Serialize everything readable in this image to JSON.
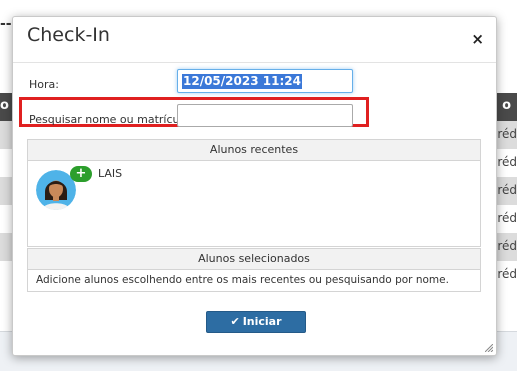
{
  "background": {
    "header_left": "o d",
    "header_right": "o",
    "rows": [
      "créd",
      "créd",
      "créd",
      "créd",
      "créd",
      "créd"
    ]
  },
  "modal": {
    "title": "Check-In",
    "close_icon": "×",
    "hora_label": "Hora:",
    "hora_value": "12/05/2023 11:24",
    "pesquisar_label": "Pesquisar nome ou matrícula:",
    "pesquisar_value": "",
    "recentes_header": "Alunos recentes",
    "recent_students": [
      {
        "name": "LAIS",
        "add_icon": "+"
      }
    ],
    "selecionados_header": "Alunos selecionados",
    "selecionados_hint": "Adicione alunos escolhendo entre os mais recentes ou pesquisando por nome.",
    "iniciar_label": "Iniciar"
  },
  "colors": {
    "highlight": "#e02020",
    "primary_button": "#2d6da3",
    "add_badge": "#2c9e2c",
    "selected_text_bg": "#3b78d8"
  }
}
